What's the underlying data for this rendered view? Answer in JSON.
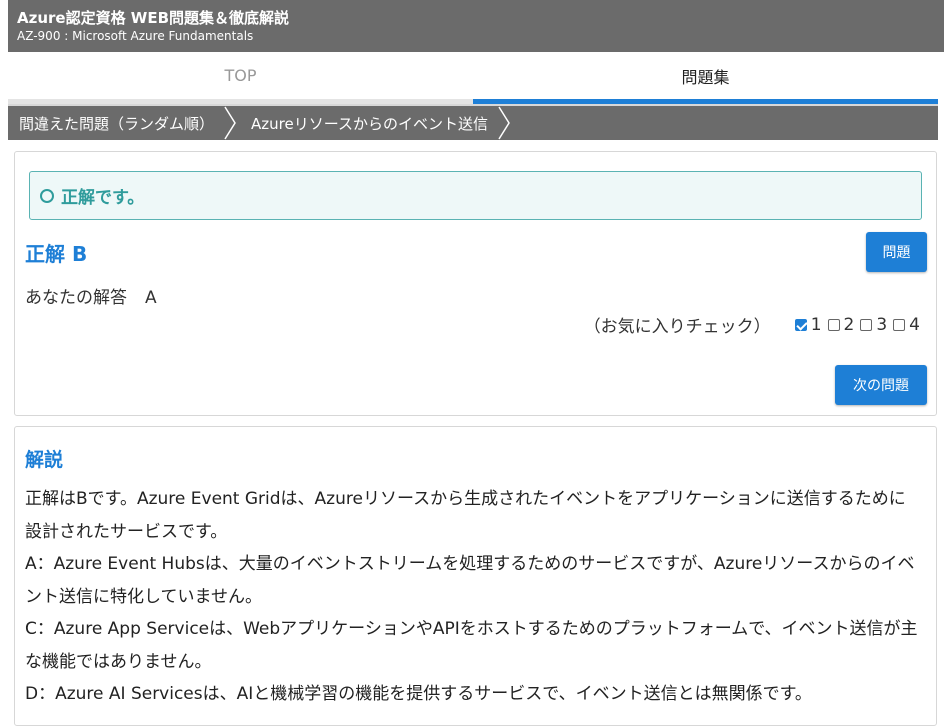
{
  "header": {
    "site_title": "Azure認定資格 WEB問題集＆徹底解説",
    "site_subtitle": "AZ-900 : Microsoft Azure Fundamentals"
  },
  "tabs": [
    {
      "label": "TOP",
      "active": false
    },
    {
      "label": "問題集",
      "active": true
    }
  ],
  "breadcrumb": [
    {
      "label": "間違えた問題（ランダム順）"
    },
    {
      "label": "Azureリソースからのイベント送信"
    }
  ],
  "result": {
    "message": "正解です。",
    "correct_answer": "正解 B",
    "question_button": "問題",
    "your_answer_label": "あなたの解答",
    "your_answer_value": "A",
    "favorite_label": "（お気に入りチェック）",
    "favorites": [
      {
        "label": "1",
        "checked": true
      },
      {
        "label": "2",
        "checked": false
      },
      {
        "label": "3",
        "checked": false
      },
      {
        "label": "4",
        "checked": false
      }
    ],
    "next_button": "次の問題"
  },
  "explanation": {
    "title": "解説",
    "paragraphs": [
      "正解はBです。Azure Event Gridは、Azureリソースから生成されたイベントをアプリケーションに送信するために設計されたサービスです。",
      "A：Azure Event Hubsは、大量のイベントストリームを処理するためのサービスですが、Azureリソースからのイベント送信に特化していません。",
      "C：Azure App Serviceは、WebアプリケーションやAPIをホストするためのプラットフォームで、イベント送信が主な機能ではありません。",
      "D：Azure AI Servicesは、AIと機械学習の機能を提供するサービスで、イベント送信とは無関係です。"
    ]
  },
  "colors": {
    "accent": "#1e7fd6",
    "header_bg": "#6b6b6b",
    "success": "#2f9c9c"
  }
}
